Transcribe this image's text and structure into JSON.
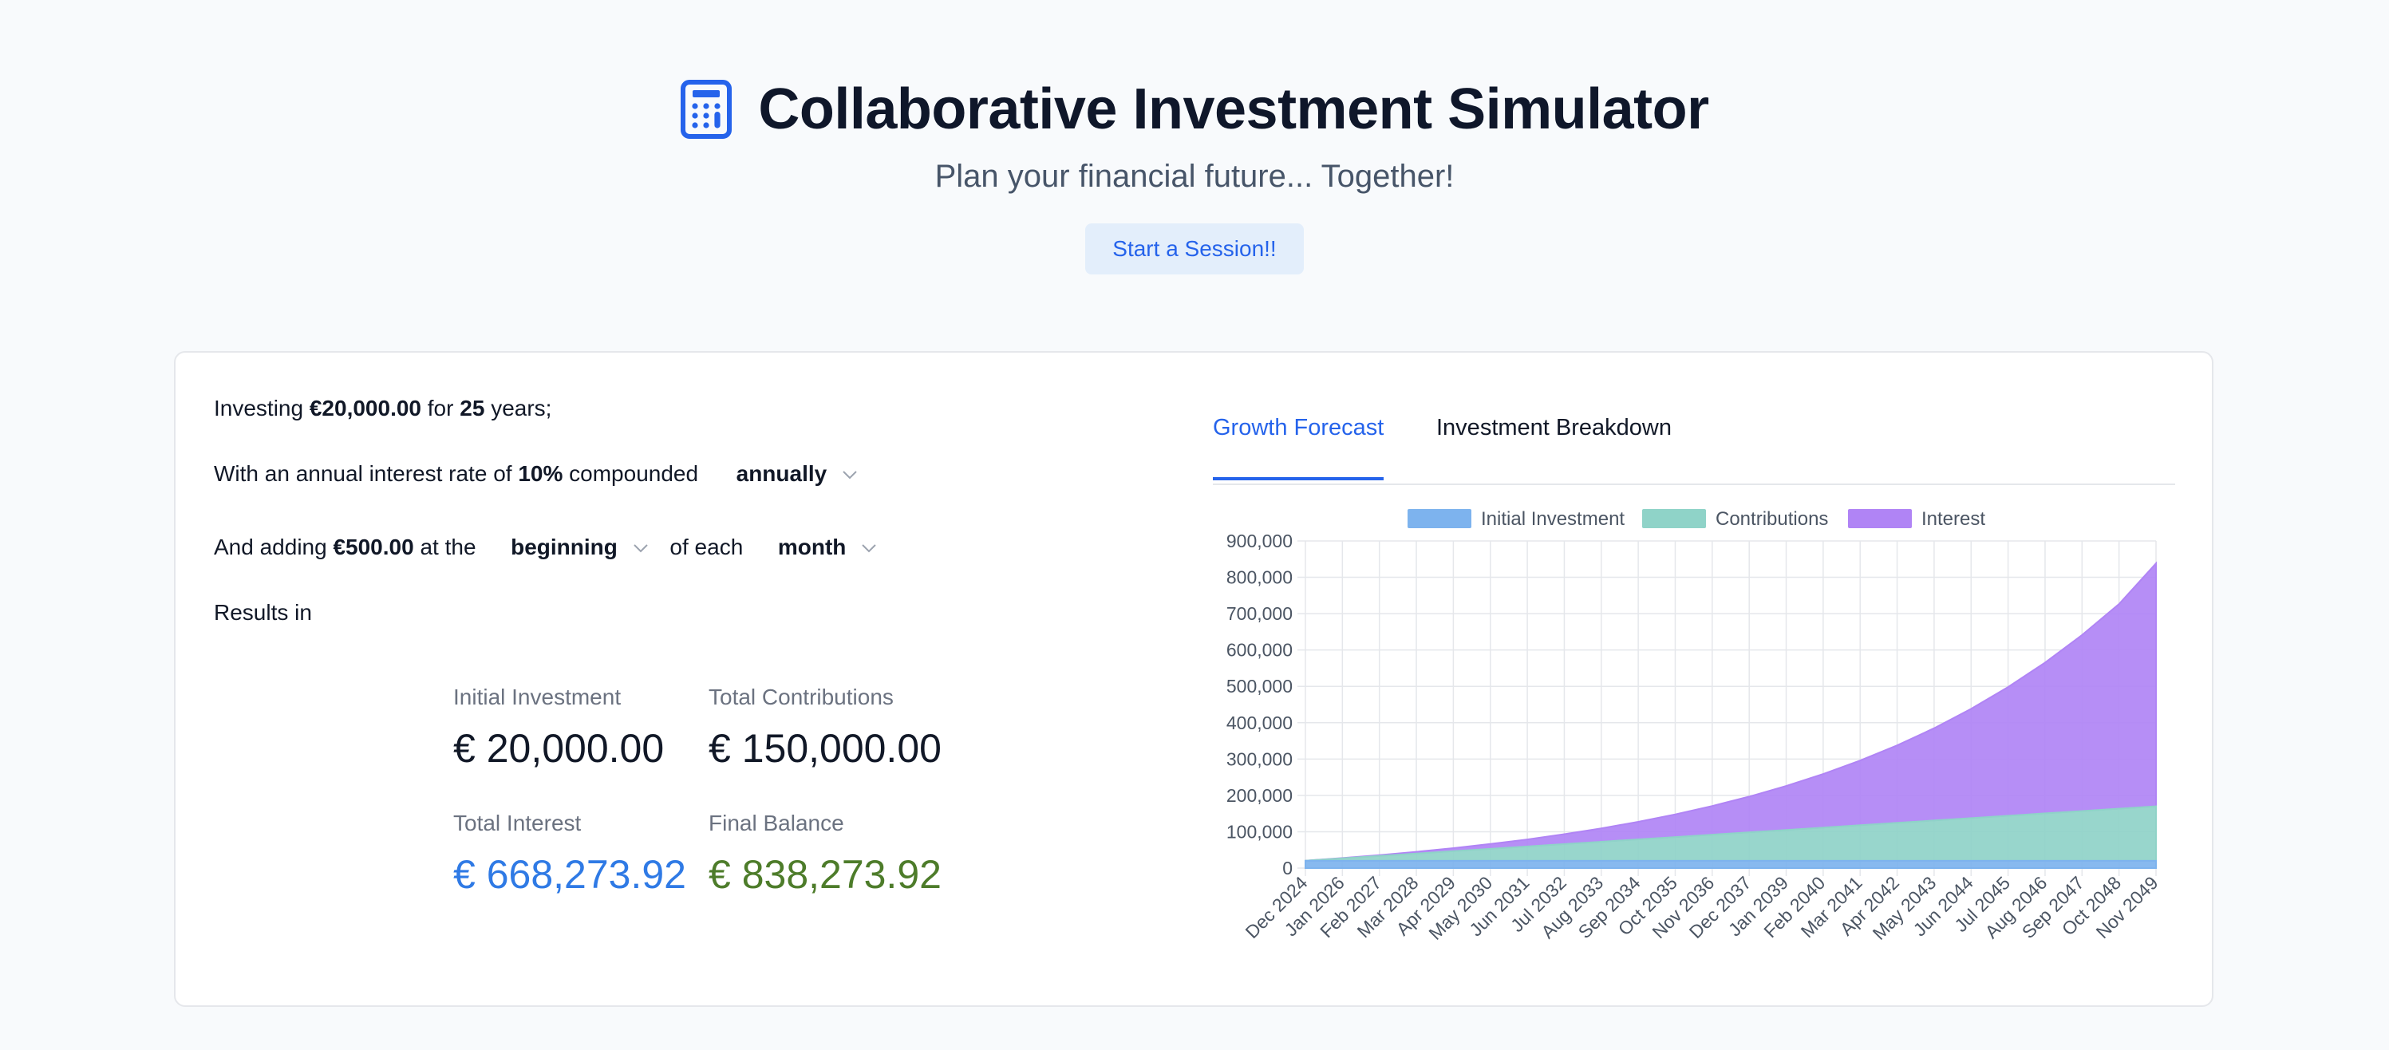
{
  "header": {
    "title": "Collaborative Investment Simulator",
    "subtitle": "Plan your financial future... Together!",
    "start_button": "Start a Session!!",
    "icon": "calculator-icon"
  },
  "inputs": {
    "line1": {
      "prefix": "Investing",
      "amount": "€20,000.00",
      "mid": "for",
      "years": "25",
      "suffix": "years;"
    },
    "line2": {
      "prefix": "With an annual interest rate of",
      "rate": "10%",
      "mid": "compounded",
      "compounding": "annually"
    },
    "line3": {
      "prefix": "And adding",
      "contribution": "€500.00",
      "mid": "at the",
      "timing": "beginning",
      "mid2": "of each",
      "period": "month"
    },
    "results_label": "Results in"
  },
  "results": {
    "initial_label": "Initial Investment",
    "initial_value": "€ 20,000.00",
    "contrib_label": "Total Contributions",
    "contrib_value": "€ 150,000.00",
    "interest_label": "Total Interest",
    "interest_value": "€ 668,273.92",
    "final_label": "Final Balance",
    "final_value": "€ 838,273.92"
  },
  "tabs": [
    {
      "label": "Growth Forecast",
      "active": true
    },
    {
      "label": "Investment Breakdown",
      "active": false
    }
  ],
  "colors": {
    "initial": "#7db3ee",
    "contributions": "#8fd3c8",
    "interest": "#b084f5",
    "accent": "#2563eb",
    "interest_text": "#2f7ae5",
    "final_text": "#4d7c2a"
  },
  "chart_data": {
    "type": "area",
    "stacked": true,
    "legend_position": "top",
    "grid": true,
    "ylim": [
      0,
      900000
    ],
    "y_ticks": [
      "0",
      "100,000",
      "200,000",
      "300,000",
      "400,000",
      "500,000",
      "600,000",
      "700,000",
      "800,000",
      "900,000"
    ],
    "categories": [
      "Dec 2024",
      "Jan 2026",
      "Feb 2027",
      "Mar 2028",
      "Apr 2029",
      "May 2030",
      "Jun 2031",
      "Jul 2032",
      "Aug 2033",
      "Sep 2034",
      "Oct 2035",
      "Nov 2036",
      "Dec 2037",
      "Jan 2039",
      "Feb 2040",
      "Mar 2041",
      "Apr 2042",
      "May 2043",
      "Jun 2044",
      "Jul 2045",
      "Aug 2046",
      "Sep 2047",
      "Oct 2048",
      "Nov 2049"
    ],
    "series": [
      {
        "name": "Initial Investment",
        "values": [
          20000,
          20000,
          20000,
          20000,
          20000,
          20000,
          20000,
          20000,
          20000,
          20000,
          20000,
          20000,
          20000,
          20000,
          20000,
          20000,
          20000,
          20000,
          20000,
          20000,
          20000,
          20000,
          20000,
          20000
        ]
      },
      {
        "name": "Contributions",
        "values": [
          500,
          7000,
          13500,
          20000,
          26500,
          33000,
          39500,
          46000,
          52500,
          59000,
          65500,
          72000,
          78500,
          85000,
          91500,
          98000,
          104500,
          111000,
          117500,
          124000,
          130500,
          137000,
          143500,
          150000
        ]
      },
      {
        "name": "Interest",
        "values": [
          0,
          700,
          2300,
          4800,
          8400,
          13200,
          19400,
          27200,
          36800,
          48400,
          62300,
          78800,
          98200,
          120900,
          147300,
          177900,
          213200,
          253900,
          300600,
          354000,
          415000,
          484300,
          563000,
          668274
        ]
      }
    ]
  }
}
